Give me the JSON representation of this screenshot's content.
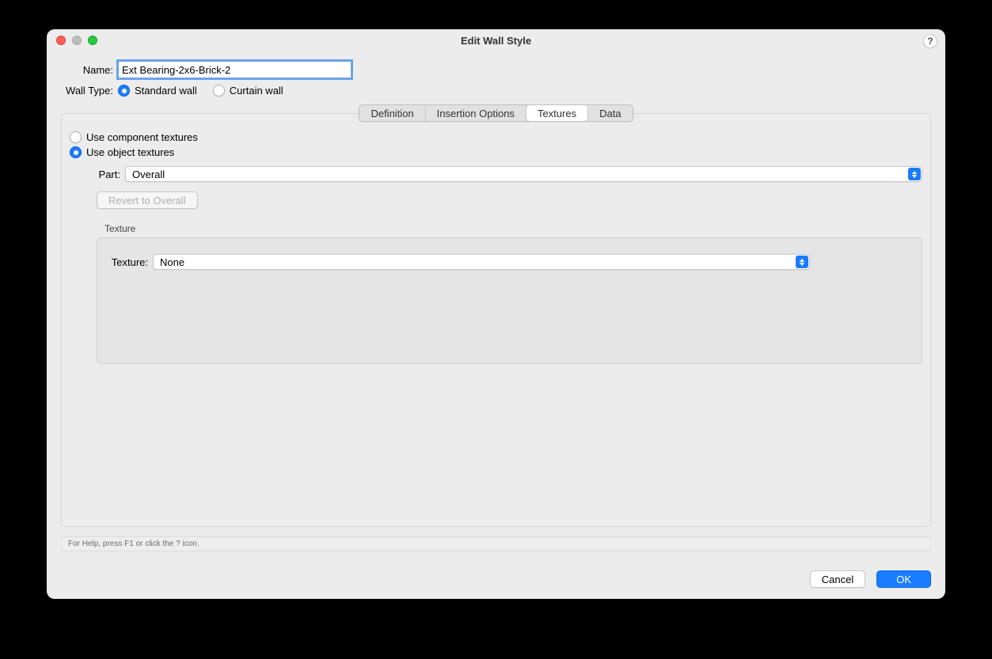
{
  "window": {
    "title": "Edit Wall Style"
  },
  "labels": {
    "name": "Name:",
    "wall_type": "Wall Type:",
    "part": "Part:",
    "texture_group": "Texture",
    "texture_field": "Texture:"
  },
  "name_value": "Ext Bearing-2x6-Brick-2",
  "wall_type_options": {
    "standard": "Standard wall",
    "curtain": "Curtain wall"
  },
  "tabs": {
    "definition": "Definition",
    "insertion": "Insertion Options",
    "textures": "Textures",
    "data": "Data"
  },
  "texture_mode": {
    "component": "Use component textures",
    "object": "Use object textures"
  },
  "part_value": "Overall",
  "buttons": {
    "revert": "Revert to Overall",
    "cancel": "Cancel",
    "ok": "OK"
  },
  "texture_value": "None",
  "status_text": "For Help, press F1 or click the ? icon."
}
